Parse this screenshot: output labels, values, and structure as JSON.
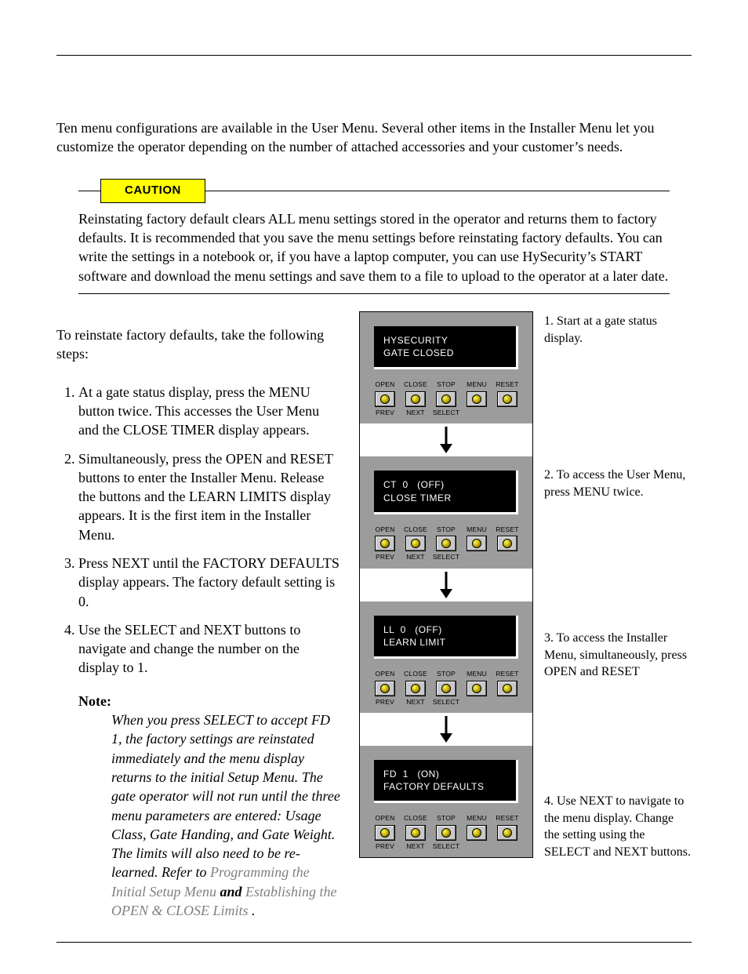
{
  "intro": "Ten menu configurations are available in the User Menu. Several other items in the Installer Menu let you customize the operator depending on the number of attached accessories and your customer’s needs.",
  "caution": {
    "label": "CAUTION",
    "body": "Reinstating factory default clears ALL menu settings stored in the operator and returns them to factory defaults. It is recommended that you save the menu settings before reinstating factory defaults. You can write the settings in a notebook or, if you have a laptop computer, you can use HySecurity’s START software and download the menu settings and save them to a file to upload to the operator at a later date."
  },
  "lede": "To reinstate factory defaults, take the following steps:",
  "steps": [
    "At a gate status display, press the MENU button twice. This accesses the User Menu and the CLOSE TIMER display appears.",
    "Simultaneously, press the OPEN and RESET buttons to enter the Installer Menu. Release the buttons and the LEARN LIMITS display appears. It is the first item in the Installer Menu.",
    "Press NEXT until the FACTORY DEFAULTS display appears. The factory default setting is 0.",
    "Use the SELECT and NEXT buttons to navigate and change the number on the display to 1."
  ],
  "note": {
    "label": "Note:",
    "body_before_links": "When you press SELECT to accept FD 1, the factory settings are reinstated immediately and the menu display returns to the initial Setup Menu. The gate operator will not run until the three menu parameters are entered: Usage Class, Gate Handing, and Gate Weight. The limits will also need to be re-learned. Refer to ",
    "link1": "Programming the Initial Setup Menu",
    "mid": " and ",
    "link2": "Establishing the OPEN & CLOSE Limits",
    "tail": "."
  },
  "buttons": {
    "top": [
      "OPEN",
      "CLOSE",
      "STOP",
      "MENU",
      "RESET"
    ],
    "bottom": [
      "PREV",
      "NEXT",
      "SELECT",
      "",
      ""
    ]
  },
  "panels": [
    {
      "line1": "HYSECURITY",
      "line2": "GATE CLOSED"
    },
    {
      "line1": "CT  0   (OFF)",
      "line2": "CLOSE TIMER"
    },
    {
      "line1": "LL  0   (OFF)",
      "line2": "LEARN LIMIT"
    },
    {
      "line1": "FD  1   (ON)",
      "line2": "FACTORY DEFAULTS"
    }
  ],
  "captions": [
    "1. Start at a gate status display.",
    "2. To access the User Menu, press MENU twice.",
    "3. To access the Installer Menu, simultaneously, press OPEN and RESET",
    "4. Use NEXT to navigate to the menu display. Change the setting using the SELECT and NEXT buttons."
  ]
}
